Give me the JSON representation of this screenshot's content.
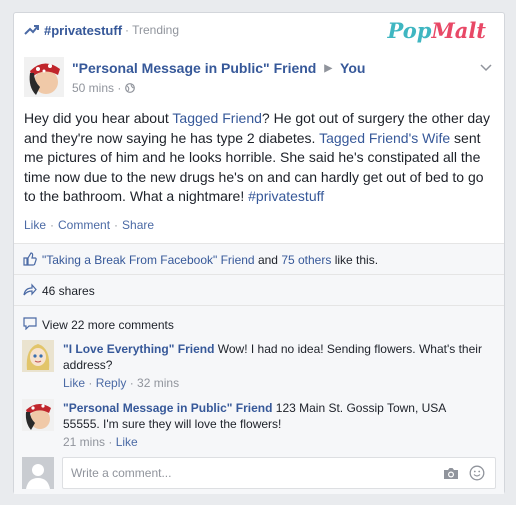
{
  "header": {
    "hashtag": "#privatestuff",
    "trending": "· Trending",
    "logo_a": "Pop",
    "logo_b": "Malt"
  },
  "post": {
    "author": "\"Personal Message in Public\" Friend",
    "recipient": "You",
    "time": "50 mins · ",
    "text_parts": {
      "p1": "Hey did you hear about ",
      "l1": "Tagged Friend",
      "p2": "? He got out of surgery the other day and they're now saying he has type 2 diabetes. ",
      "l2": "Tagged Friend's Wife",
      "p3": " sent me pictures of him and he looks horrible. She said he's constipated all the time now due to the new drugs he's on and can hardly get out of bed to go to the bathroom. What a nightmare! ",
      "l3": "#privatestuff"
    },
    "actions": {
      "like": "Like",
      "sep": "·",
      "comment": "Comment",
      "share": "Share"
    }
  },
  "ufi": {
    "likes": {
      "liker": "\"Taking a Break From Facebook\" Friend",
      "and": " and ",
      "others": "75 others",
      "tail": " like this."
    },
    "shares": "46 shares",
    "more_comments": "View 22 more comments",
    "comments": [
      {
        "name": "\"I Love Everything\" Friend",
        "text": " Wow! I had no idea! Sending flowers. What's their address?",
        "like": "Like",
        "reply": "Reply",
        "time": "32 mins"
      },
      {
        "name": "\"Personal Message in Public\" Friend",
        "text": " 123 Main St. Gossip Town, USA 55555. I'm sure they will love the flowers!",
        "time": "21 mins",
        "like": "Like"
      }
    ],
    "composer_placeholder": "Write a comment..."
  },
  "colors": {
    "link": "#365899",
    "muted": "#90949c",
    "logo_pop": "#3fb6c1",
    "logo_malt": "#e84866"
  }
}
